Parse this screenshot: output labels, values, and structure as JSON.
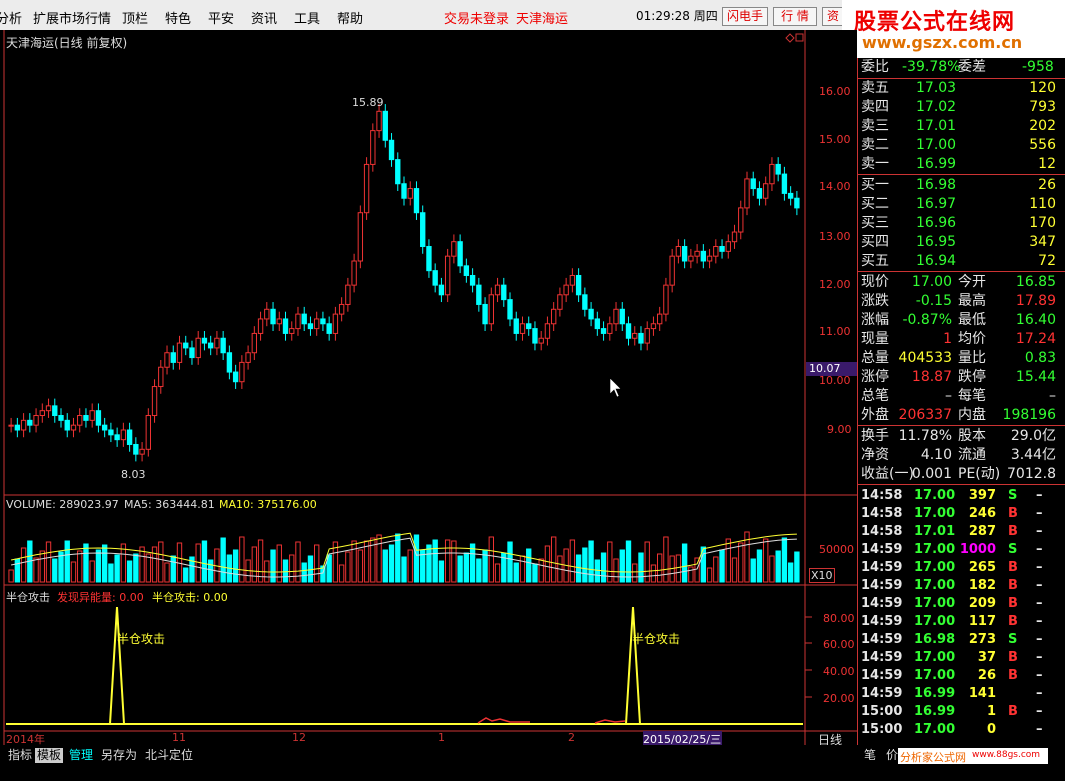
{
  "menu": [
    "分析",
    "扩展市场行情",
    "顶栏",
    "特色",
    "平安",
    "资讯",
    "工具",
    "帮助"
  ],
  "login_status": "交易未登录",
  "stock_name_top": "天津海运",
  "clock": "01:29:28",
  "weekday": "周四",
  "buttons": {
    "flash": "闪电手",
    "quote": "行 情",
    "info": "资"
  },
  "logo": {
    "line1": "股票公式在线网",
    "line2": "www.gszx.com.cn"
  },
  "main_chart": {
    "title": "天津海运(日线 前复权)",
    "high_label": "15.89",
    "low_label": "8.03",
    "price_axis": [
      "16.00",
      "15.00",
      "14.00",
      "13.00",
      "12.00",
      "11.00",
      "10.00",
      "9.00"
    ],
    "current_price_tag": "10.07"
  },
  "volume": {
    "label_volume": "VOLUME: 289023.97",
    "label_ma5": "MA5: 363444.81",
    "label_ma10": "MA10: 375176.00",
    "axis_label": "50000",
    "unit": "X10"
  },
  "indicator": {
    "name": "半仓攻击",
    "label_discover": "发现异能量: 0.00",
    "label_attack": "半仓攻击: 0.00",
    "axis": [
      "80.00",
      "60.00",
      "40.00",
      "20.00"
    ],
    "signal_text": "半仓攻击"
  },
  "time_axis": {
    "year": "2014年",
    "ticks": [
      "11",
      "12",
      "1",
      "2"
    ],
    "cursor_date": "2015/02/25/三",
    "period": "日线"
  },
  "bottom_tabs": [
    "指标",
    "模板",
    "管理",
    "另存为",
    "北斗定位"
  ],
  "bottom_right": [
    "笔",
    "价"
  ],
  "watermark_bottom": "分析家公式网",
  "watermark_bottom_url": "www.88gs.com",
  "quote": {
    "weibi": {
      "label": "委比",
      "value": "-39.78%",
      "label2": "委差",
      "value2": "-958"
    },
    "asks": [
      {
        "label": "卖五",
        "price": "17.03",
        "vol": "120"
      },
      {
        "label": "卖四",
        "price": "17.02",
        "vol": "793"
      },
      {
        "label": "卖三",
        "price": "17.01",
        "vol": "202"
      },
      {
        "label": "卖二",
        "price": "17.00",
        "vol": "556"
      },
      {
        "label": "卖一",
        "price": "16.99",
        "vol": "12"
      }
    ],
    "bids": [
      {
        "label": "买一",
        "price": "16.98",
        "vol": "26"
      },
      {
        "label": "买二",
        "price": "16.97",
        "vol": "110"
      },
      {
        "label": "买三",
        "price": "16.96",
        "vol": "170"
      },
      {
        "label": "买四",
        "price": "16.95",
        "vol": "347"
      },
      {
        "label": "买五",
        "price": "16.94",
        "vol": "72"
      }
    ],
    "stats": [
      {
        "l1": "现价",
        "v1": "17.00",
        "c1": "g",
        "l2": "今开",
        "v2": "16.85",
        "c2": "g"
      },
      {
        "l1": "涨跌",
        "v1": "-0.15",
        "c1": "g",
        "l2": "最高",
        "v2": "17.89",
        "c2": "r"
      },
      {
        "l1": "涨幅",
        "v1": "-0.87%",
        "c1": "g",
        "l2": "最低",
        "v2": "16.40",
        "c2": "g"
      },
      {
        "l1": "现量",
        "v1": "1",
        "c1": "r",
        "l2": "均价",
        "v2": "17.24",
        "c2": "r"
      },
      {
        "l1": "总量",
        "v1": "404533",
        "c1": "y",
        "l2": "量比",
        "v2": "0.83",
        "c2": "g"
      },
      {
        "l1": "涨停",
        "v1": "18.87",
        "c1": "r",
        "l2": "跌停",
        "v2": "15.44",
        "c2": "g"
      },
      {
        "l1": "总笔",
        "v1": "–",
        "c1": "w",
        "l2": "每笔",
        "v2": "–",
        "c2": "w"
      },
      {
        "l1": "外盘",
        "v1": "206337",
        "c1": "r",
        "l2": "内盘",
        "v2": "198196",
        "c2": "g"
      }
    ],
    "finance": [
      {
        "l1": "换手",
        "v1": "11.78%",
        "l2": "股本",
        "v2": "29.0亿"
      },
      {
        "l1": "净资",
        "v1": "4.10",
        "l2": "流通",
        "v2": "3.44亿"
      },
      {
        "l1": "收益(一)",
        "v1": "0.001",
        "l2": "PE(动)",
        "v2": "7012.8"
      }
    ],
    "ticks": [
      {
        "t": "14:58",
        "p": "17.00",
        "v": "397",
        "s": "S",
        "vc": "y"
      },
      {
        "t": "14:58",
        "p": "17.00",
        "v": "246",
        "s": "B",
        "vc": "y"
      },
      {
        "t": "14:58",
        "p": "17.01",
        "v": "287",
        "s": "B",
        "vc": "y"
      },
      {
        "t": "14:59",
        "p": "17.00",
        "v": "1000",
        "s": "S",
        "vc": "m"
      },
      {
        "t": "14:59",
        "p": "17.00",
        "v": "265",
        "s": "B",
        "vc": "y"
      },
      {
        "t": "14:59",
        "p": "17.00",
        "v": "182",
        "s": "B",
        "vc": "y"
      },
      {
        "t": "14:59",
        "p": "17.00",
        "v": "209",
        "s": "B",
        "vc": "y"
      },
      {
        "t": "14:59",
        "p": "17.00",
        "v": "117",
        "s": "B",
        "vc": "y"
      },
      {
        "t": "14:59",
        "p": "16.98",
        "v": "273",
        "s": "S",
        "vc": "y"
      },
      {
        "t": "14:59",
        "p": "17.00",
        "v": "37",
        "s": "B",
        "vc": "y"
      },
      {
        "t": "14:59",
        "p": "17.00",
        "v": "26",
        "s": "B",
        "vc": "y"
      },
      {
        "t": "14:59",
        "p": "16.99",
        "v": "141",
        "s": "",
        "vc": "y"
      },
      {
        "t": "15:00",
        "p": "16.99",
        "v": "1",
        "s": "B",
        "vc": "y"
      },
      {
        "t": "15:00",
        "p": "17.00",
        "v": "0",
        "s": "",
        "vc": "y"
      }
    ],
    "tick_dash": "–"
  }
}
